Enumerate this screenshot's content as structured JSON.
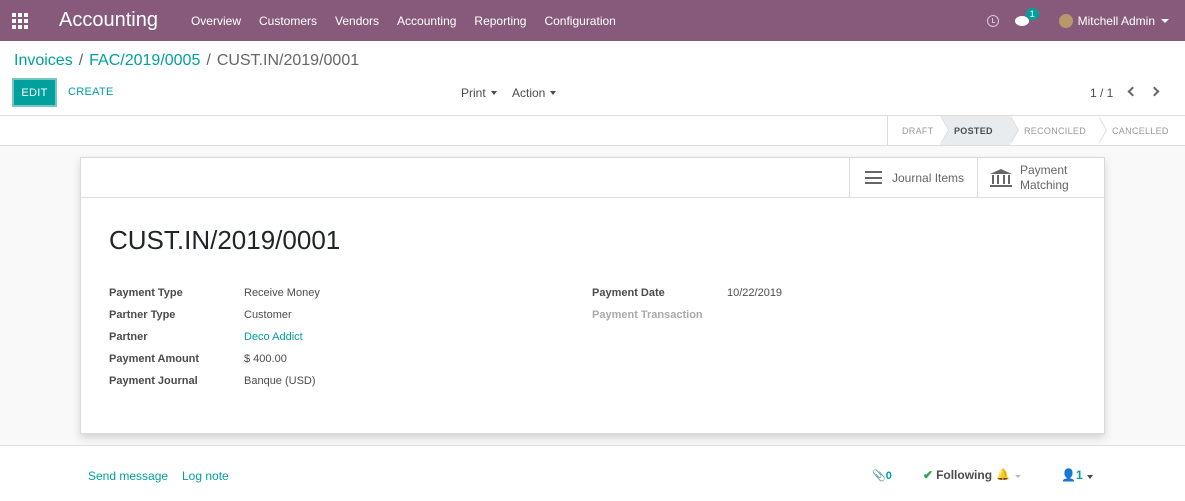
{
  "navbar": {
    "app_name": "Accounting",
    "menu": [
      "Overview",
      "Customers",
      "Vendors",
      "Accounting",
      "Reporting",
      "Configuration"
    ],
    "chat_count": "1",
    "user_name": "Mitchell Admin",
    "bg_color": "#875a7b"
  },
  "breadcrumb": {
    "items": [
      "Invoices",
      "FAC/2019/0005"
    ],
    "separator": "/",
    "active": "CUST.IN/2019/0001"
  },
  "toolbar": {
    "edit_label": "EDIT",
    "create_label": "CREATE",
    "print_label": "Print",
    "action_label": "Action",
    "pager": "1 / 1"
  },
  "statusbar": {
    "stages": [
      "DRAFT",
      "POSTED",
      "RECONCILED",
      "CANCELLED"
    ],
    "current": "POSTED"
  },
  "smart_buttons": {
    "journal_items": "Journal Items",
    "payment_matching_1": "Payment",
    "payment_matching_2": "Matching"
  },
  "record": {
    "title": "CUST.IN/2019/0001",
    "left_fields": [
      {
        "label": "Payment Type",
        "value": "Receive Money"
      },
      {
        "label": "Partner Type",
        "value": "Customer"
      },
      {
        "label": "Partner",
        "value": "Deco Addict"
      },
      {
        "label": "Payment Amount",
        "value": "$ 400.00"
      },
      {
        "label": "Payment Journal",
        "value": "Banque (USD)"
      }
    ],
    "right_fields": [
      {
        "label": "Payment Date",
        "value": "10/22/2019"
      },
      {
        "label": "Payment Transaction",
        "value": ""
      }
    ]
  },
  "chatter": {
    "send_message": "Send message",
    "log_note": "Log note",
    "attachments_count": "0",
    "following_label": "Following",
    "followers_count": "1"
  },
  "colors": {
    "accent": "#00a09d",
    "brand": "#875a7b"
  }
}
